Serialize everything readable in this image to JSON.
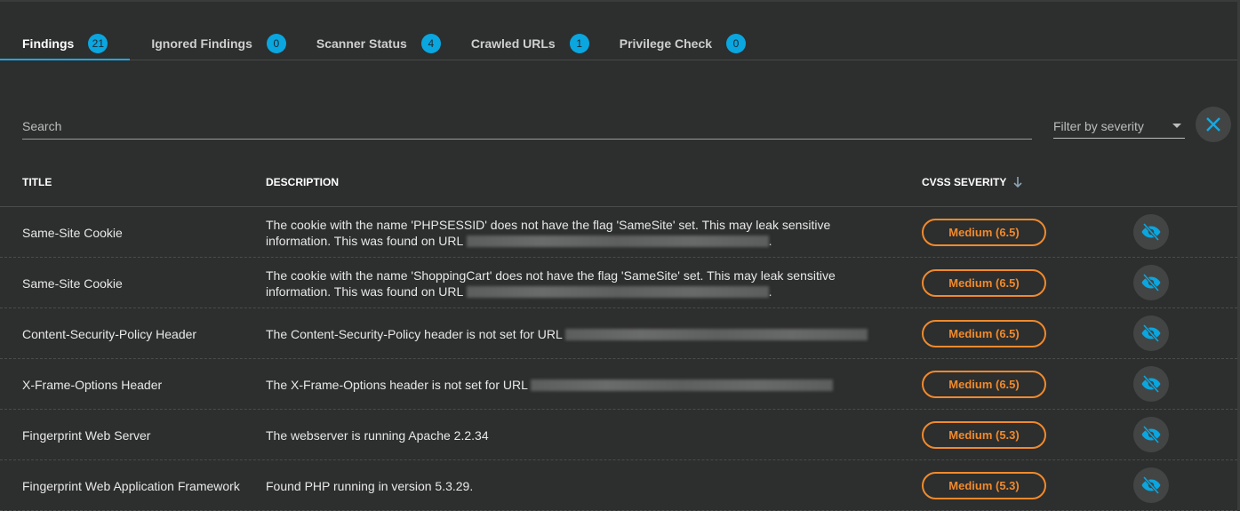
{
  "tabs": [
    {
      "label": "Findings",
      "count": "21",
      "active": true
    },
    {
      "label": "Ignored Findings",
      "count": "0"
    },
    {
      "label": "Scanner Status",
      "count": "4"
    },
    {
      "label": "Crawled URLs",
      "count": "1"
    },
    {
      "label": "Privilege Check",
      "count": "0"
    }
  ],
  "search": {
    "placeholder": "Search",
    "value": ""
  },
  "filter": {
    "label": "Filter by severity"
  },
  "columns": {
    "title": "TITLE",
    "description": "DESCRIPTION",
    "severity": "CVSS SEVERITY"
  },
  "colors": {
    "accent": "#0aa6e0",
    "medium": "#f08a2c",
    "background": "#2d2e2e"
  },
  "rows": [
    {
      "title": "Same-Site Cookie",
      "desc": "The cookie with the name 'PHPSESSID' does not have the flag 'SameSite' set. This may leak sensitive information. This was found on URL",
      "suffix": ".",
      "redacted": true,
      "severity": "Medium (6.5)"
    },
    {
      "title": "Same-Site Cookie",
      "desc": "The cookie with the name 'ShoppingCart' does not have the flag 'SameSite' set. This may leak sensitive information. This was found on URL",
      "suffix": ".",
      "redacted": true,
      "severity": "Medium (6.5)"
    },
    {
      "title": "Content-Security-Policy Header",
      "desc": "The Content-Security-Policy header is not set for URL",
      "suffix": "",
      "redacted": true,
      "severity": "Medium (6.5)"
    },
    {
      "title": "X-Frame-Options Header",
      "desc": "The X-Frame-Options header is not set for URL",
      "suffix": "",
      "redacted": true,
      "severity": "Medium (6.5)"
    },
    {
      "title": "Fingerprint Web Server",
      "desc": "The webserver is running Apache 2.2.34",
      "suffix": "",
      "redacted": false,
      "severity": "Medium (5.3)"
    },
    {
      "title": "Fingerprint Web Application Framework",
      "desc": "Found PHP running in version 5.3.29.",
      "suffix": "",
      "redacted": false,
      "severity": "Medium (5.3)"
    }
  ]
}
